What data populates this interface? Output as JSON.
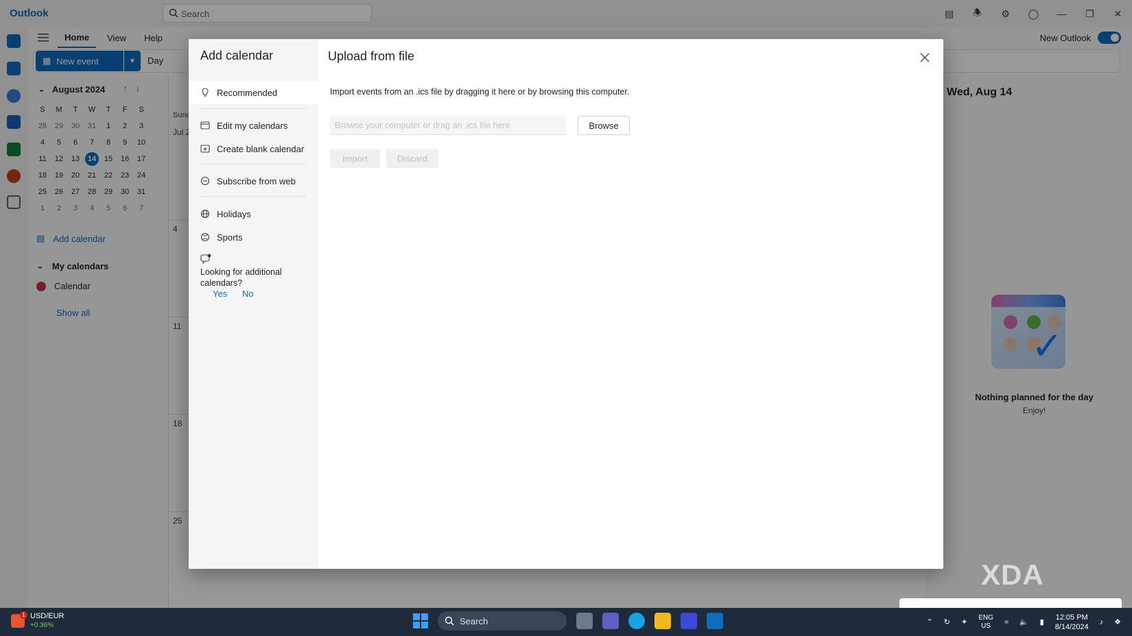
{
  "app": {
    "title": "Outlook"
  },
  "search": {
    "placeholder": "Search"
  },
  "ribbon": {
    "tabs": [
      {
        "label": "Home"
      },
      {
        "label": "View"
      },
      {
        "label": "Help"
      }
    ],
    "new_event": "New event",
    "view_mode": "Day"
  },
  "new_outlook": {
    "label": "New Outlook",
    "enabled": true
  },
  "mini_calendar": {
    "month": "August 2024",
    "weekdays": [
      "S",
      "M",
      "T",
      "W",
      "T",
      "F",
      "S"
    ],
    "weeks": [
      [
        "28",
        "29",
        "30",
        "31",
        "1",
        "2",
        "3"
      ],
      [
        "4",
        "5",
        "6",
        "7",
        "8",
        "9",
        "10"
      ],
      [
        "11",
        "12",
        "13",
        "14",
        "15",
        "16",
        "17"
      ],
      [
        "18",
        "19",
        "20",
        "21",
        "22",
        "23",
        "24"
      ],
      [
        "25",
        "26",
        "27",
        "28",
        "29",
        "30",
        "31"
      ],
      [
        "1",
        "2",
        "3",
        "4",
        "5",
        "6",
        "7"
      ]
    ],
    "today": "14"
  },
  "left_pane": {
    "add_calendar": "Add calendar",
    "my_calendars": "My calendars",
    "calendar": "Calendar",
    "show_all": "Show all"
  },
  "calendar_grid": {
    "day_header": "Sund",
    "first_date": "Jul 2",
    "week_numbers": [
      "4",
      "11",
      "18",
      "25"
    ]
  },
  "right_pane": {
    "date": "Wed, Aug 14",
    "empty_title": "Nothing planned for the day",
    "empty_sub": "Enjoy!"
  },
  "dialog": {
    "title": "Add calendar",
    "nav": [
      {
        "label": "Recommended",
        "icon": "lightbulb-icon"
      },
      {
        "label": "Edit my calendars",
        "icon": "edit-calendar-icon"
      },
      {
        "label": "Create blank calendar",
        "icon": "calendar-add-icon"
      },
      {
        "label": "Subscribe from web",
        "icon": "link-icon"
      },
      {
        "label": "Holidays",
        "icon": "globe-icon"
      },
      {
        "label": "Sports",
        "icon": "ball-icon"
      }
    ],
    "feedback": {
      "question": "Looking for additional calendars?",
      "yes": "Yes",
      "no": "No"
    },
    "main": {
      "heading": "Upload from file",
      "description": "Import events from an .ics file by dragging it here or by browsing this computer.",
      "file_placeholder": "Browse your computer or drag an .ics file here",
      "browse": "Browse",
      "import": "Import",
      "discard": "Discard"
    }
  },
  "taskbar": {
    "stock_name": "USD/EUR",
    "stock_change": "+0.36%",
    "stock_badge": "1",
    "search": "Search",
    "lang_top": "ENG",
    "lang_bottom": "US",
    "time": "12:05 PM",
    "date": "8/14/2024"
  },
  "watermark": "XDA",
  "colors": {
    "accent": "#0f6cbd",
    "calendar_red": "#c4314b"
  }
}
